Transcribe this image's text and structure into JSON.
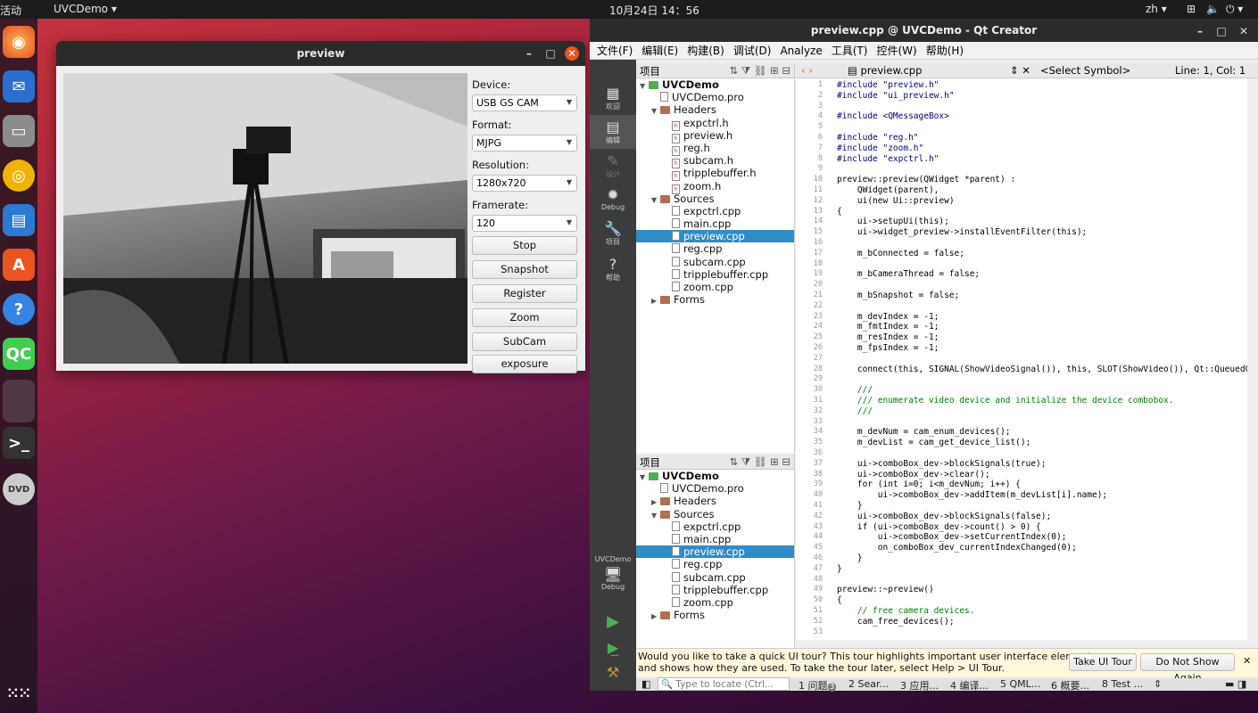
{
  "topbar": {
    "activities": "活动",
    "app": "UVCDemo ▾",
    "clock": "10月24日 14：56",
    "lang": "zh ▾"
  },
  "preview": {
    "title": "preview",
    "device_label": "Device:",
    "device_value": "USB GS CAM",
    "format_label": "Format:",
    "format_value": "MJPG",
    "resolution_label": "Resolution:",
    "resolution_value": "1280x720",
    "framerate_label": "Framerate:",
    "framerate_value": "120",
    "buttons": [
      "Stop",
      "Snapshot",
      "Register",
      "Zoom",
      "SubCam",
      "exposure"
    ]
  },
  "qt": {
    "title": "preview.cpp @ UVCDemo - Qt Creator",
    "menus": [
      "文件(F)",
      "编辑(E)",
      "构建(B)",
      "调试(D)",
      "Analyze",
      "工具(T)",
      "控件(W)",
      "帮助(H)"
    ],
    "side": [
      "欢迎",
      "编辑",
      "设计",
      "Debug",
      "项目",
      "帮助"
    ],
    "kit": "UVCDemo",
    "kit_mode": "Debug",
    "projects_label": "项目",
    "editor_file": "preview.cpp",
    "symbol": "<Select Symbol>",
    "linecol": "Line: 1, Col: 1",
    "tree": [
      {
        "t": "UVCDemo",
        "d": 0,
        "k": "root",
        "b": true
      },
      {
        "t": "UVCDemo.pro",
        "d": 1,
        "k": "file"
      },
      {
        "t": "Headers",
        "d": 1,
        "k": "folder"
      },
      {
        "t": "expctrl.h",
        "d": 2,
        "k": "h"
      },
      {
        "t": "preview.h",
        "d": 2,
        "k": "h"
      },
      {
        "t": "reg.h",
        "d": 2,
        "k": "h"
      },
      {
        "t": "subcam.h",
        "d": 2,
        "k": "h"
      },
      {
        "t": "tripplebuffer.h",
        "d": 2,
        "k": "h"
      },
      {
        "t": "zoom.h",
        "d": 2,
        "k": "h"
      },
      {
        "t": "Sources",
        "d": 1,
        "k": "folder"
      },
      {
        "t": "expctrl.cpp",
        "d": 2,
        "k": "c"
      },
      {
        "t": "main.cpp",
        "d": 2,
        "k": "c"
      },
      {
        "t": "preview.cpp",
        "d": 2,
        "k": "c",
        "sel": true
      },
      {
        "t": "reg.cpp",
        "d": 2,
        "k": "c"
      },
      {
        "t": "subcam.cpp",
        "d": 2,
        "k": "c"
      },
      {
        "t": "tripplebuffer.cpp",
        "d": 2,
        "k": "c"
      },
      {
        "t": "zoom.cpp",
        "d": 2,
        "k": "c"
      },
      {
        "t": "Forms",
        "d": 1,
        "k": "folder"
      }
    ],
    "tree2": [
      {
        "t": "UVCDemo",
        "d": 0,
        "k": "root",
        "b": true
      },
      {
        "t": "UVCDemo.pro",
        "d": 1,
        "k": "file"
      },
      {
        "t": "Headers",
        "d": 1,
        "k": "folder"
      },
      {
        "t": "Sources",
        "d": 1,
        "k": "folder"
      },
      {
        "t": "expctrl.cpp",
        "d": 2,
        "k": "c"
      },
      {
        "t": "main.cpp",
        "d": 2,
        "k": "c"
      },
      {
        "t": "preview.cpp",
        "d": 2,
        "k": "c",
        "sel": true
      },
      {
        "t": "reg.cpp",
        "d": 2,
        "k": "c"
      },
      {
        "t": "subcam.cpp",
        "d": 2,
        "k": "c"
      },
      {
        "t": "tripplebuffer.cpp",
        "d": 2,
        "k": "c"
      },
      {
        "t": "zoom.cpp",
        "d": 2,
        "k": "c"
      },
      {
        "t": "Forms",
        "d": 1,
        "k": "folder"
      }
    ],
    "code": [
      "#include \"preview.h\"",
      "#include \"ui_preview.h\"",
      "",
      "#include <QMessageBox>",
      "",
      "#include \"reg.h\"",
      "#include \"zoom.h\"",
      "#include \"expctrl.h\"",
      "",
      "preview::preview(QWidget *parent) :",
      "    QWidget(parent),",
      "    ui(new Ui::preview)",
      "{",
      "    ui->setupUi(this);",
      "    ui->widget_preview->installEventFilter(this);",
      "",
      "    m_bConnected = false;",
      "",
      "    m_bCameraThread = false;",
      "",
      "    m_bSnapshot = false;",
      "",
      "    m_devIndex = -1;",
      "    m_fmtIndex = -1;",
      "    m_resIndex = -1;",
      "    m_fpsIndex = -1;",
      "",
      "    connect(this, SIGNAL(ShowVideoSignal()), this, SLOT(ShowVideo()), Qt::QueuedConnec",
      "",
      "    ///",
      "    /// enumerate video device and initialize the device combobox.",
      "    ///",
      "",
      "    m_devNum = cam_enum_devices();",
      "    m_devList = cam_get_device_list();",
      "",
      "    ui->comboBox_dev->blockSignals(true);",
      "    ui->comboBox_dev->clear();",
      "    for (int i=0; i<m_devNum; i++) {",
      "        ui->comboBox_dev->addItem(m_devList[i].name);",
      "    }",
      "    ui->comboBox_dev->blockSignals(false);",
      "    if (ui->comboBox_dev->count() > 0) {",
      "        ui->comboBox_dev->setCurrentIndex(0);",
      "        on_comboBox_dev_currentIndexChanged(0);",
      "    }",
      "}",
      "",
      "preview::~preview()",
      "{",
      "    // free camera devices.",
      "    cam_free_devices();",
      ""
    ],
    "tour_text1": "Would you like to take a quick UI tour? This tour highlights important user interface elements",
    "tour_text2": "and shows how they are used. To take the tour later, select Help > UI Tour.",
    "tour_btn": "Take UI Tour",
    "no_show_btn": "Do Not Show Again",
    "locate_placeholder": "Type to locate (Ctrl...",
    "status_tabs": [
      "1 问题",
      "2 Sear...",
      "3 应用...",
      "4 编译...",
      "5 QML...",
      "6 概要...",
      "8 Test ..."
    ],
    "problem_count": "3"
  }
}
